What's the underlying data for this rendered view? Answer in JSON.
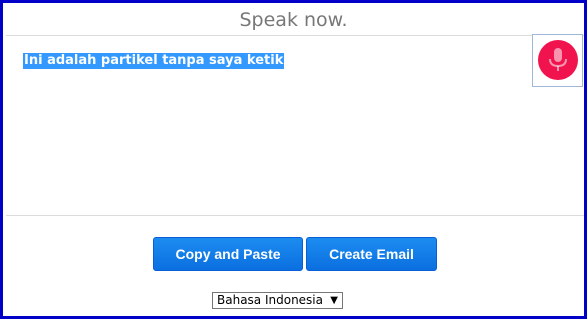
{
  "status": {
    "prompt": "Speak now."
  },
  "transcript": {
    "text": "Ini adalah partikel tanpa saya ketik",
    "selected": true
  },
  "mic": {
    "icon": "microphone-icon",
    "color": "#f0134d"
  },
  "actions": {
    "copy_paste_label": "Copy and Paste",
    "create_email_label": "Create Email"
  },
  "language": {
    "selected": "Bahasa Indonesia"
  },
  "colors": {
    "frame_border": "#0000c8",
    "button_blue": "#0b6fe0",
    "selection_highlight": "#3399ff"
  }
}
